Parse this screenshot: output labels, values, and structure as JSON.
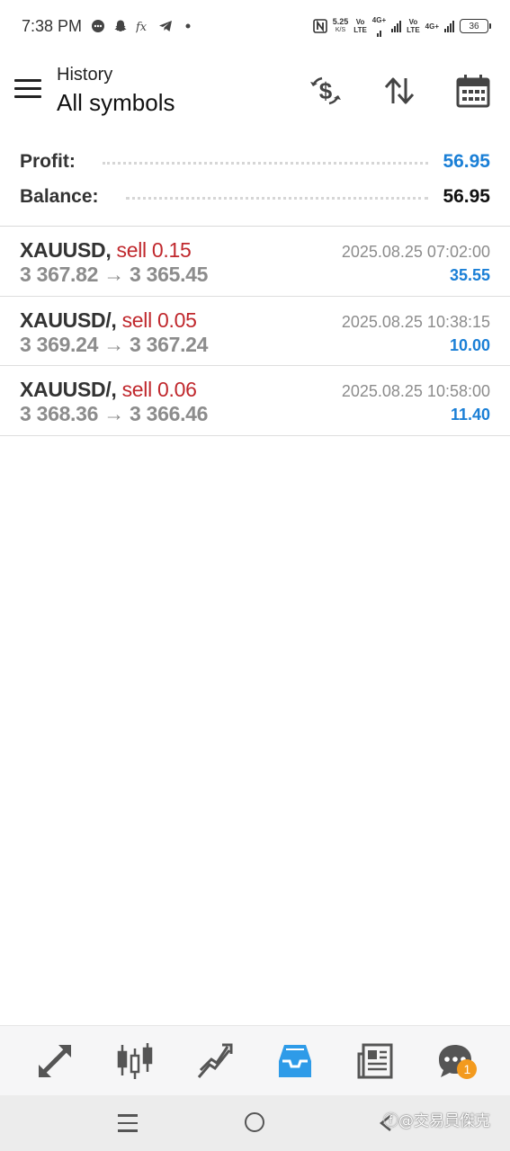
{
  "status_bar": {
    "time": "7:38 PM",
    "net_speed": "5.25",
    "net_unit": "K/S",
    "sim1_label_top": "Vo",
    "sim1_label_bottom": "LTE",
    "sim1_network": "4G+",
    "sim2_label_top": "Vo",
    "sim2_label_bottom": "LTE",
    "sim2_network": "4G+",
    "battery": "36"
  },
  "header": {
    "subtitle": "History",
    "title": "All symbols"
  },
  "summary": {
    "profit_label": "Profit:",
    "profit_value": "56.95",
    "balance_label": "Balance:",
    "balance_value": "56.95"
  },
  "deals": [
    {
      "symbol": "XAUUSD,",
      "side": "sell 0.15",
      "prices": "3 367.82 → 3 365.45",
      "time": "2025.08.25 07:02:00",
      "profit": "35.55"
    },
    {
      "symbol": "XAUUSD/,",
      "side": "sell 0.05",
      "prices": "3 369.24 → 3 367.24",
      "time": "2025.08.25 10:38:15",
      "profit": "10.00"
    },
    {
      "symbol": "XAUUSD/,",
      "side": "sell 0.06",
      "prices": "3 368.36 → 3 366.46",
      "time": "2025.08.25 10:58:00",
      "profit": "11.40"
    }
  ],
  "bottom_nav": {
    "chat_badge": "1",
    "active": "history",
    "active_color": "#2e9be8"
  },
  "watermark": "ⓕ@交易員傑克",
  "colors": {
    "profit_blue": "#1a7fd6",
    "sell_red": "#c0282d",
    "badge_orange": "#f39a1e"
  }
}
